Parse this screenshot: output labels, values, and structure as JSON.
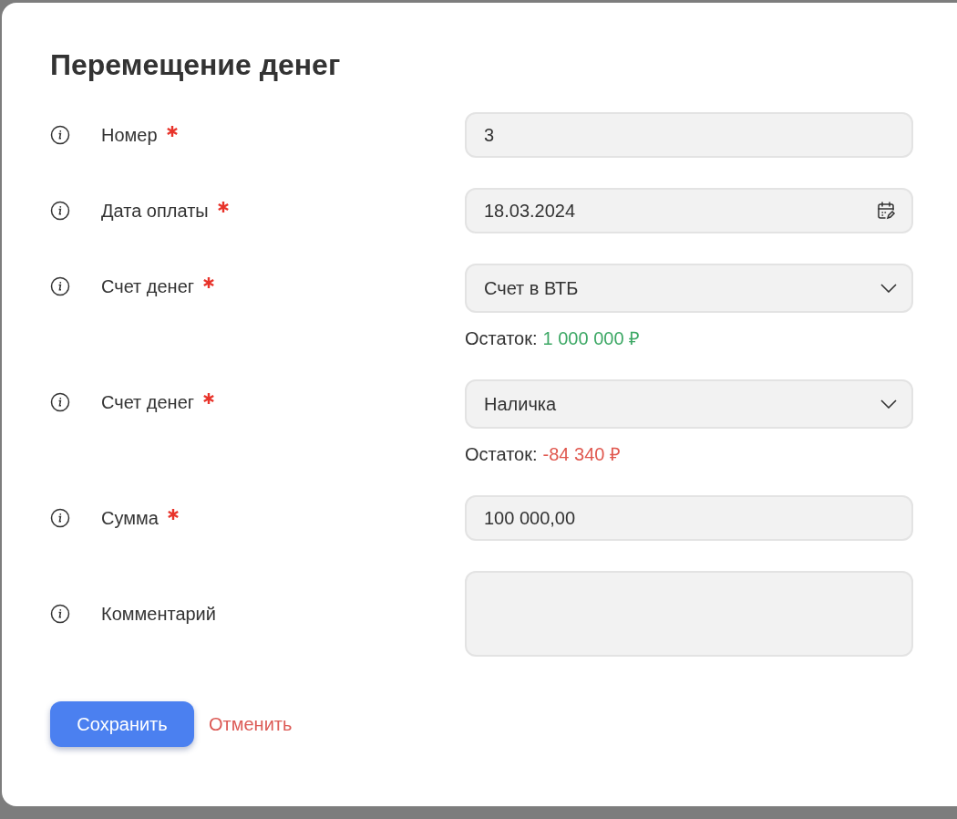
{
  "dialog": {
    "title": "Перемещение денег"
  },
  "fields": [
    {
      "kind": "text",
      "label": "Номер",
      "required": true,
      "value": "3"
    },
    {
      "kind": "date",
      "label": "Дата оплаты",
      "required": true,
      "value": "18.03.2024"
    },
    {
      "kind": "select",
      "label": "Счет денег",
      "required": true,
      "value": "Счет в ВТБ",
      "balance": {
        "label": "Остаток:",
        "value": "1 000 000 ₽",
        "color": "#3da865"
      }
    },
    {
      "kind": "select",
      "label": "Счет денег",
      "required": true,
      "value": "Наличка",
      "balance": {
        "label": "Остаток:",
        "value": "-84 340 ₽",
        "color": "#e0584f"
      }
    },
    {
      "kind": "text",
      "label": "Сумма",
      "required": true,
      "value": "100 000,00"
    },
    {
      "kind": "textarea",
      "label": "Комментарий",
      "required": false
    }
  ],
  "buttons": {
    "save": "Сохранить",
    "cancel": "Отменить"
  }
}
